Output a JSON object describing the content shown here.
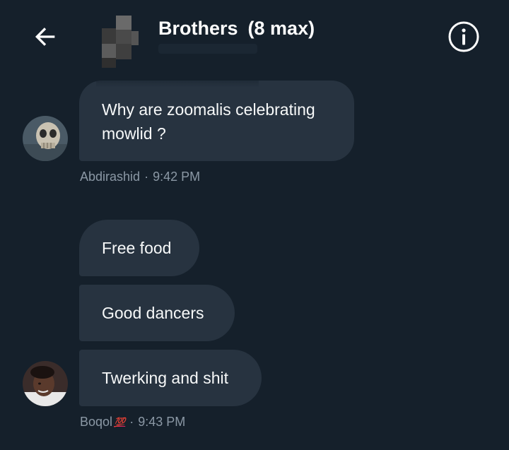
{
  "header": {
    "title": "Brothers",
    "member_count": "(8 max)",
    "back_icon": "arrow-left-icon",
    "info_icon": "info-circle-icon"
  },
  "colors": {
    "background": "#15202b",
    "bubble": "#273340",
    "meta_text": "#8b98a5"
  },
  "messages": [
    {
      "text": "Why are zoomalis celebrating mowlid ?",
      "line1": "Why are zoomalis celebrating",
      "line2": "mowlid ?",
      "sender": "Abdirashid",
      "time": "9:42 PM"
    },
    {
      "text": "Free food"
    },
    {
      "text": "Good dancers"
    },
    {
      "text": "Twerking and shit",
      "sender": "Boqol",
      "sender_emoji": "💯",
      "time": "9:43 PM"
    }
  ],
  "meta_separator": "·"
}
